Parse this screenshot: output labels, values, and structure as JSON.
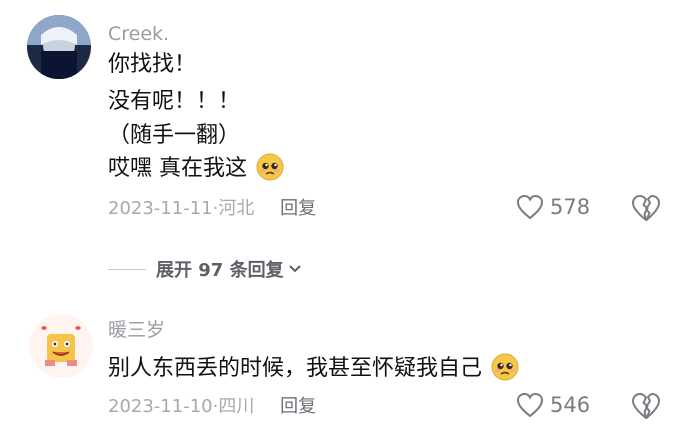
{
  "comments": [
    {
      "username": "Creek.",
      "lines": [
        "你找找！",
        "没有呢！！！",
        "（随手一翻）",
        "哎嘿 真在我这"
      ],
      "date": "2023-11-11",
      "location": "河北",
      "reply_label": "回复",
      "likes": "578",
      "emoji": "pleading-face-icon"
    },
    {
      "username": "暖三岁",
      "lines": [
        "别人东西丢的时候，我甚至怀疑我自己"
      ],
      "date": "2023-11-10",
      "location": "四川",
      "reply_label": "回复",
      "likes": "546",
      "emoji": "pleading-face-icon"
    }
  ],
  "expand_replies": {
    "label": "展开 97 条回复"
  },
  "colors": {
    "meta": "#a8a9ad",
    "name": "#9a9ca2",
    "text": "#111111"
  }
}
